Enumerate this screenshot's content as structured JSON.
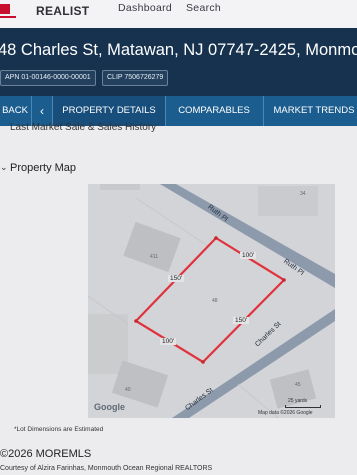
{
  "app": {
    "brand": "REALIST",
    "nav": [
      "Dashboard",
      "Search"
    ]
  },
  "header": {
    "address": "48 Charles St, Matawan, NJ 07747-2425, Monmou",
    "apn": "APN 01-00146-0000-00001",
    "clip": "CLIP 7506726279"
  },
  "tabs": {
    "back": "BACK",
    "items": [
      "PROPERTY DETAILS",
      "COMPARABLES",
      "MARKET TRENDS"
    ],
    "active": "PROPERTY DETAILS"
  },
  "sections": {
    "previous": "Last Market Sale & Sales History",
    "current": "Property Map"
  },
  "map": {
    "streets": [
      "Ruth Pl",
      "Ruth Pl",
      "Charles St",
      "Charles St"
    ],
    "lot_number": "48",
    "neighbor_lots": [
      "34",
      "411",
      "40",
      "45"
    ],
    "dimensions": [
      "100'",
      "150'",
      "150'",
      "100'"
    ],
    "google_label": "Google",
    "scale": "25 yards",
    "attribution": "Map data ©2026 Google",
    "lot_line_color": "#e0323c"
  },
  "footer": {
    "note": "*Lot Dimensions are Estimated",
    "copyright": "©2026 MOREMLS",
    "courtesy": "Courtesy of Alzira Farinhas, Monmouth Ocean Regional REALTORS"
  },
  "colors": {
    "header_bg": "#16324f",
    "tab_bar": "#1b5d8e"
  }
}
